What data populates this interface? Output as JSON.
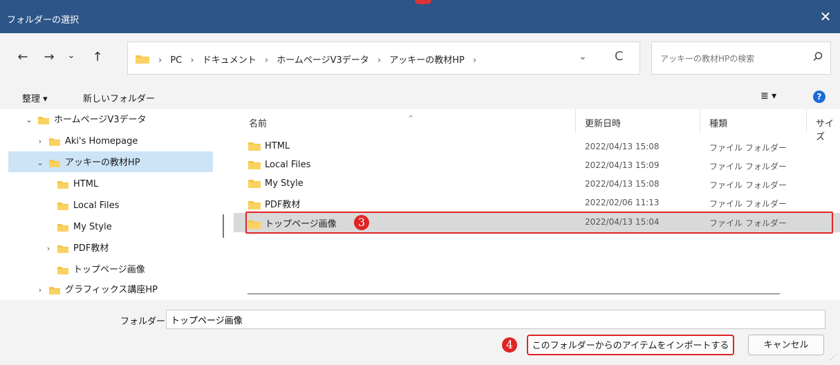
{
  "window": {
    "title": "フォルダーの選択",
    "close_glyph": "✕"
  },
  "nav": {
    "back_glyph": "←",
    "forward_glyph": "→",
    "recent_glyph": "⌄",
    "up_glyph": "↑",
    "address": {
      "crumbs": [
        "PC",
        "ドキュメント",
        "ホームページV3データ",
        "アッキーの教材HP"
      ],
      "separator": "›",
      "dropdown_glyph": "⌄",
      "refresh_glyph": "C"
    },
    "search": {
      "placeholder": "アッキーの教材HPの検索",
      "icon": "search-icon"
    }
  },
  "toolbar": {
    "organize_label": "整理 ▾",
    "new_folder_label": "新しいフォルダー",
    "view_glyph": "≣ ▾",
    "help_glyph": "?"
  },
  "tree": {
    "items": [
      {
        "label": "ホームページV3データ",
        "chev": "⌄"
      },
      {
        "label": "Aki's Homepage",
        "chev": "›"
      },
      {
        "label": "アッキーの教材HP",
        "chev": "⌄"
      },
      {
        "label": "HTML",
        "chev": ""
      },
      {
        "label": "Local Files",
        "chev": ""
      },
      {
        "label": "My Style",
        "chev": ""
      },
      {
        "label": "PDF教材",
        "chev": "›"
      },
      {
        "label": "トップページ画像",
        "chev": ""
      },
      {
        "label": "グラフィックス講座HP",
        "chev": "›"
      }
    ]
  },
  "filelist": {
    "columns": [
      "名前",
      "更新日時",
      "種類",
      "サイズ"
    ],
    "sort_glyph": "^",
    "rows": [
      {
        "name": "HTML",
        "date": "2022/04/13 15:08",
        "type": "ファイル フォルダー"
      },
      {
        "name": "Local Files",
        "date": "2022/04/13 15:09",
        "type": "ファイル フォルダー"
      },
      {
        "name": "My Style",
        "date": "2022/04/13 15:08",
        "type": "ファイル フォルダー"
      },
      {
        "name": "PDF教材",
        "date": "2022/02/06 11:13",
        "type": "ファイル フォルダー"
      },
      {
        "name": "トップページ画像",
        "date": "2022/04/13 15:04",
        "type": "ファイル フォルダー"
      }
    ],
    "selected_row": 4
  },
  "bottom": {
    "folder_label": "フォルダー:",
    "folder_value": "トップページ画像",
    "import_button": "このフォルダーからのアイテムをインポートする",
    "cancel_button": "キャンセル"
  },
  "annotations": {
    "badge3": "3",
    "badge4": "4"
  },
  "colors": {
    "titlebar": "#2d5588",
    "highlight": "#e02424",
    "folder": "#f6c343",
    "tree_selected": "#cde4f7"
  }
}
